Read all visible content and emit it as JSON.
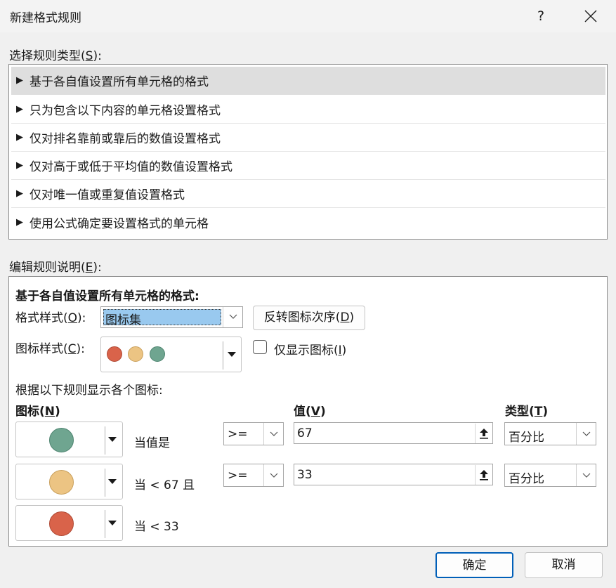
{
  "window": {
    "title": "新建格式规则",
    "help": "?"
  },
  "rule_type": {
    "label_prefix": "选择规则类型(",
    "label_key": "S",
    "label_suffix": "):",
    "items": [
      {
        "label": "基于各自值设置所有单元格的格式",
        "selected": true
      },
      {
        "label": "只为包含以下内容的单元格设置格式",
        "selected": false
      },
      {
        "label": "仅对排名靠前或靠后的数值设置格式",
        "selected": false
      },
      {
        "label": "仅对高于或低于平均值的数值设置格式",
        "selected": false
      },
      {
        "label": "仅对唯一值或重复值设置格式",
        "selected": false
      },
      {
        "label": "使用公式确定要设置格式的单元格",
        "selected": false
      }
    ]
  },
  "edit": {
    "label_prefix": "编辑规则说明(",
    "label_key": "E",
    "label_suffix": "):",
    "heading": "基于各自值设置所有单元格的格式:",
    "format_style_prefix": "格式样式(",
    "format_style_key": "O",
    "format_style_suffix": "):",
    "format_style_value": "图标集",
    "reverse_prefix": "反转图标次序(",
    "reverse_key": "D",
    "reverse_suffix": ")",
    "icon_style_prefix": "图标样式(",
    "icon_style_key": "C",
    "icon_style_suffix": "):",
    "show_icon_only_prefix": "仅显示图标(",
    "show_icon_only_key": "I",
    "show_icon_only_suffix": ")",
    "rules_caption": "根据以下规则显示各个图标:",
    "col_icon_prefix": "图标(",
    "col_icon_key": "N",
    "col_icon_suffix": ")",
    "col_value_prefix": "值(",
    "col_value_key": "V",
    "col_value_suffix": ")",
    "col_type_prefix": "类型(",
    "col_type_key": "T",
    "col_type_suffix": ")",
    "rows": [
      {
        "icon_color": "#6fa590",
        "condition": "当值是",
        "operator": ">=",
        "value": "67",
        "type": "百分比"
      },
      {
        "icon_color": "#ecc483",
        "condition": "当 < 67 且",
        "operator": ">=",
        "value": "33",
        "type": "百分比"
      },
      {
        "icon_color": "#d9634a",
        "condition": "当 < 33"
      }
    ]
  },
  "icon_style_colors": [
    "#d9634a",
    "#ecc483",
    "#6fa590"
  ],
  "buttons": {
    "ok": "确定",
    "cancel": "取消"
  },
  "colors": {
    "accent": "#005fb8",
    "selection": "#99c9ef"
  }
}
